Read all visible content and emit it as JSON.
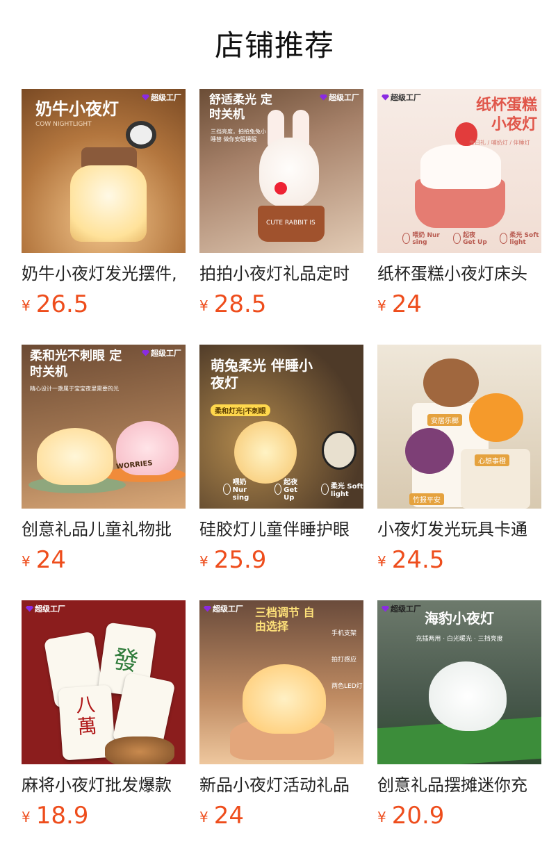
{
  "page": {
    "title": "店铺推荐"
  },
  "badge_text": "超级工厂",
  "currency": "¥",
  "products": [
    {
      "title": "奶牛小夜灯发光摆件,",
      "price": "26.5",
      "img": {
        "heading": "奶牛小夜灯",
        "sub": "COW NIGHTLIGHT"
      }
    },
    {
      "title": "拍拍小夜灯礼品定时",
      "price": "28.5",
      "img": {
        "heading": "舒适柔光 定时关机",
        "sub": "三挡亮度，拍拍兔兔小睡替 做你安眠睡眠",
        "band": "CUTE RABBIT IS"
      }
    },
    {
      "title": "纸杯蛋糕小夜灯床头",
      "price": "24",
      "img": {
        "heading": "纸杯蛋糕 小夜灯",
        "sub": "生日礼 / 哺奶灯 / 伴睡灯",
        "icons": [
          "喂奶 Nur sing",
          "起夜 Get Up",
          "柔光 Soft light"
        ]
      }
    },
    {
      "title": "创意礼品儿童礼物批",
      "price": "24",
      "img": {
        "heading": "柔和光不刺眼 定时关机",
        "sub": "精心设计一盏属于宝宝夜里需要的光",
        "band": "WORRIES"
      }
    },
    {
      "title": "硅胶灯儿童伴睡护眼",
      "price": "25.9",
      "img": {
        "heading": "萌兔柔光 伴睡小夜灯",
        "pill": "柔和灯光|不刺眼",
        "icons": [
          "喂奶 Nur sing",
          "起夜 Get Up",
          "柔光 Soft light"
        ]
      }
    },
    {
      "title": "小夜灯发光玩具卡通",
      "price": "24.5",
      "img": {
        "tags": [
          "安居乐榔",
          "心想事橙",
          "竹报平安"
        ]
      }
    },
    {
      "title": "麻将小夜灯批发爆款",
      "price": "18.9",
      "img": {
        "tiles": [
          "發",
          "八萬"
        ]
      }
    },
    {
      "title": "新品小夜灯活动礼品",
      "price": "24",
      "img": {
        "heading": "三档调节 自由选择",
        "features": [
          "手机支架",
          "拍打感应",
          "两色LED灯"
        ]
      }
    },
    {
      "title": "创意礼品摆摊迷你充",
      "price": "20.9",
      "img": {
        "heading": "海豹小夜灯",
        "sub": "充插两用 · 白光暖光 · 三挡亮度"
      }
    }
  ],
  "colors": {
    "price": "#ee4d1c",
    "title": "#222222"
  }
}
